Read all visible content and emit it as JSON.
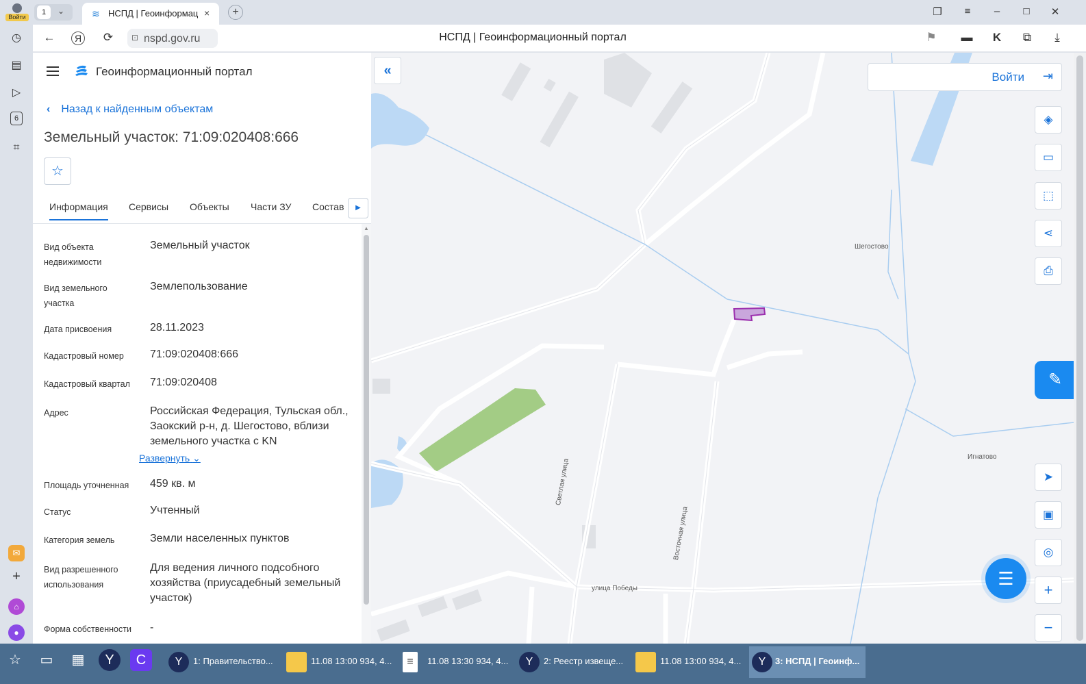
{
  "browser": {
    "account_label": "Войти",
    "tab_count": "1",
    "tab_title": "НСПД | Геоинформац",
    "url": "nspd.gov.ru",
    "page_title": "НСПД | Геоинформационный портал",
    "icons": {
      "close": "×",
      "new_tab": "+",
      "back": "←",
      "yandex": "Я",
      "reload": "⟳",
      "lock": "🔒",
      "bookmark": "⚑",
      "minimize": "–",
      "maximize": "□",
      "window_close": "✕",
      "menu": "≡",
      "download": "⤓"
    }
  },
  "sidebar": {
    "items": [
      "history-icon",
      "collections-icon",
      "video-icon",
      "tab-count-icon",
      "screenshot-icon",
      "mail-icon",
      "add-icon",
      "home-icon",
      "alice-icon"
    ],
    "badge": "6"
  },
  "app": {
    "title": "Геоинформационный портал",
    "back_link": "Назад к найденным объектам",
    "object_title": "Земельный участок: 71:09:020408:666",
    "tabs": [
      "Информация",
      "Сервисы",
      "Объекты",
      "Части ЗУ",
      "Состав"
    ],
    "properties": [
      {
        "key": "Вид объекта недвижимости",
        "value": "Земельный участок"
      },
      {
        "key": "Вид земельного участка",
        "value": "Землепользование"
      },
      {
        "key": "Дата присвоения",
        "value": "28.11.2023"
      },
      {
        "key": "Кадастровый номер",
        "value": "71:09:020408:666"
      },
      {
        "key": "Кадастровый квартал",
        "value": "71:09:020408"
      },
      {
        "key": "Адрес",
        "value": "Российская Федерация, Тульская обл., Заокский р-н, д. Шегостово, вблизи земельного участка с KN"
      },
      {
        "key": "Площадь уточненная",
        "value": "459 кв. м"
      },
      {
        "key": "Статус",
        "value": "Учтенный"
      },
      {
        "key": "Категория земель",
        "value": "Земли населенных пунктов"
      },
      {
        "key": "Вид разрешенного использования",
        "value": "Для ведения личного подсобного хозяйства (приусадебный земельный участок)"
      },
      {
        "key": "Форма собственности",
        "value": "-"
      }
    ],
    "expand_label": "Развернуть"
  },
  "map": {
    "login_label": "Войти",
    "labels": {
      "village1": "Шегостово",
      "village2": "Игнатово",
      "street1": "Светлая улица",
      "street2": "Восточная улица",
      "street3": "улица Победы"
    },
    "tools": [
      "layers-icon",
      "ruler-icon",
      "select-area-icon",
      "share-icon",
      "print-icon",
      "navigate-icon",
      "minimap-icon",
      "locate-icon",
      "zoom-in-icon",
      "zoom-out-icon"
    ],
    "colors": {
      "water": "#bcd9f5",
      "green": "#a3cc85",
      "parcel": "#c9a6dc",
      "parcel_border": "#9b2fae",
      "accent": "#1a73d9"
    }
  },
  "taskbar": {
    "items": [
      {
        "label": "1: Правительство...",
        "icon": "yandex-browser-icon"
      },
      {
        "label": "11.08 13:00 934, 4...",
        "icon": "folder-icon"
      },
      {
        "label": "11.08 13:30 934, 4...",
        "icon": "document-icon"
      },
      {
        "label": "2: Реестр извеще...",
        "icon": "yandex-browser-icon"
      },
      {
        "label": "11.08 13:00 934, 4...",
        "icon": "folder-icon"
      },
      {
        "label": "3: НСПД | Геоинф...",
        "icon": "yandex-browser-icon"
      }
    ]
  }
}
